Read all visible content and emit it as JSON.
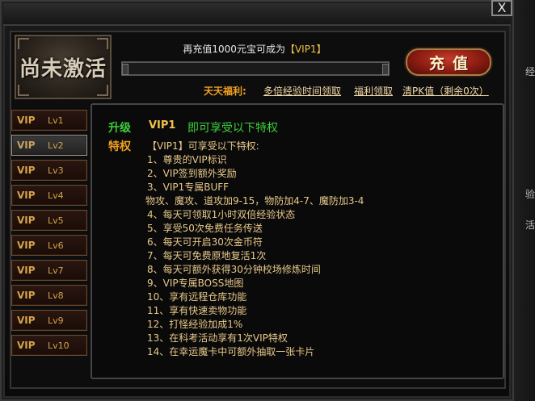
{
  "window": {
    "close_label": "X"
  },
  "badge": {
    "text": "尚未激活"
  },
  "recharge": {
    "prefix": "再充值1000元宝可成为",
    "target": "【VIP1】",
    "progress": 0.0,
    "button_label": "充值"
  },
  "welfare": {
    "label": "天天福利:",
    "links": [
      "多倍经验时间领取",
      "福利领取",
      "清PK值（剩余0次）"
    ]
  },
  "vip_levels": [
    {
      "vip": "VIP",
      "lv": "Lv1"
    },
    {
      "vip": "VIP",
      "lv": "Lv2"
    },
    {
      "vip": "VIP",
      "lv": "Lv3"
    },
    {
      "vip": "VIP",
      "lv": "Lv4"
    },
    {
      "vip": "VIP",
      "lv": "Lv5"
    },
    {
      "vip": "VIP",
      "lv": "Lv6"
    },
    {
      "vip": "VIP",
      "lv": "Lv7"
    },
    {
      "vip": "VIP",
      "lv": "Lv8"
    },
    {
      "vip": "VIP",
      "lv": "Lv9"
    },
    {
      "vip": "VIP",
      "lv": "Lv10"
    }
  ],
  "selected_level": "Lv2",
  "content": {
    "upgrade_label": "升级",
    "upgrade_vip": "VIP1",
    "upgrade_text": "即可享受以下特权",
    "privilege_label": "特权",
    "privilege_intro": "【VIP1】可享受以下特权:",
    "items": [
      "1、尊贵的VIP标识",
      "2、VIP签到额外奖励",
      "3、VIP1专属BUFF",
      "物攻、魔攻、道攻加9-15，物防加4-7、魔防加3-4",
      "4、每天可领取1小时双倍经验状态",
      "5、享受50次免费任务传送",
      "6、每天可开启30次金币符",
      "7、每天可免费原地复活1次",
      "8、每天可额外获得30分钟校场修炼时间",
      "9、VIP专属BOSS地图",
      "10、享有远程仓库功能",
      "11、享有快速卖物功能",
      "12、打怪经验加成1%",
      "13、在科考活动享有1次VIP特权",
      "14、在幸运魔卡中可额外抽取一张卡片"
    ]
  },
  "right_edge": [
    "经",
    "验",
    "活"
  ],
  "colors": {
    "accent_gold": "#f0c24a",
    "green_header": "#3ccf3c",
    "orange_header": "#f0a020",
    "text_beige": "#e8c98a"
  }
}
